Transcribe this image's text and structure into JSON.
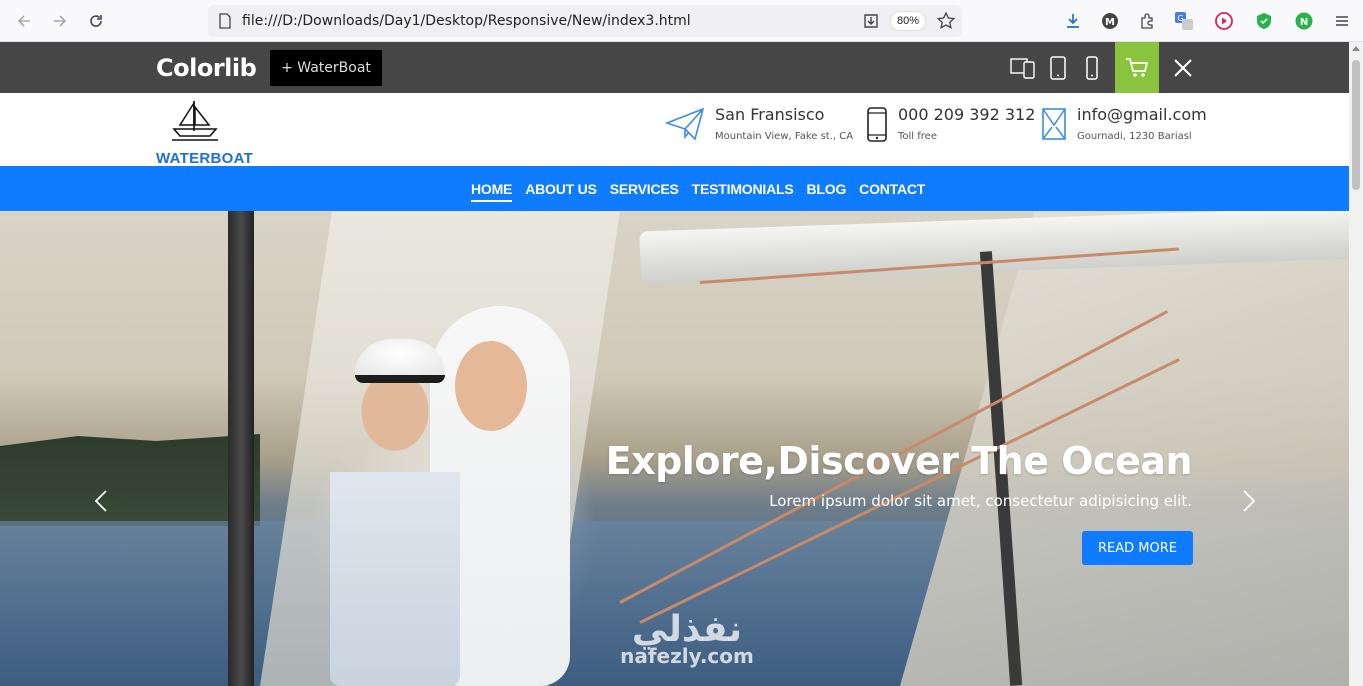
{
  "browser": {
    "url": "file:///D:/Downloads/Day1/Desktop/Responsive/New/index3.html",
    "zoom": "80%",
    "back_icon": "back-arrow-icon",
    "forward_icon": "forward-arrow-icon",
    "reload_icon": "reload-icon",
    "extensions": [
      "download-icon",
      "m-extension-icon",
      "puzzle-icon",
      "translate-icon",
      "play-icon",
      "shield-icon",
      "n-extension-icon",
      "menu-icon"
    ]
  },
  "colorlib_bar": {
    "logo": "Colorlib",
    "tag": "+ WaterBoat",
    "devices": [
      "desktop-tablet-icon",
      "tablet-icon",
      "mobile-icon"
    ],
    "cart_icon": "cart-icon",
    "close_icon": "close-icon",
    "accent_color": "#8ac43f"
  },
  "header": {
    "logo_text": "WATERBOAT",
    "contacts": [
      {
        "icon": "paper-plane-icon",
        "title": "San Fransisco",
        "sub": "Mountain View, Fake st., CA"
      },
      {
        "icon": "phone-icon",
        "title": "000 209 392 312",
        "sub": "Toll free"
      },
      {
        "icon": "envelope-icon",
        "title": "info@gmail.com",
        "sub": "Gournadi, 1230 Bariasl"
      }
    ]
  },
  "nav": {
    "items": [
      "HOME",
      "ABOUT US",
      "SERVICES",
      "TESTIMONIALS",
      "BLOG",
      "CONTACT"
    ],
    "active_index": 0,
    "color": "#0f7cff"
  },
  "hero": {
    "title": "Explore,Discover The Ocean",
    "subtitle": "Lorem ipsum dolor sit amet, consectetur adipisicing elit.",
    "button": "READ MORE",
    "watermark_top": "نفذلي",
    "watermark_bottom": "nafezly.com"
  }
}
